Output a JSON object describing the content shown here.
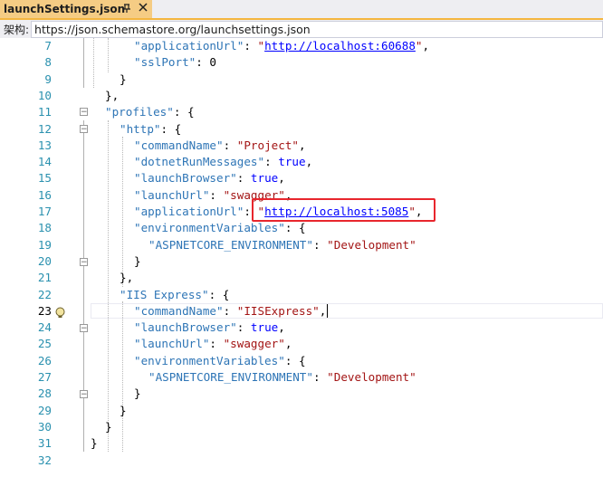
{
  "tab": {
    "title": "launchSettings.json",
    "pin_icon": "pin-icon",
    "close_icon": "close-icon"
  },
  "schema": {
    "label": "架构:",
    "url": "https://json.schemastore.org/launchsettings.json"
  },
  "editor": {
    "current_line": "23",
    "lines": [
      {
        "n": "7"
      },
      {
        "n": "8"
      },
      {
        "n": "9"
      },
      {
        "n": "10"
      },
      {
        "n": "11"
      },
      {
        "n": "12"
      },
      {
        "n": "13"
      },
      {
        "n": "14"
      },
      {
        "n": "15"
      },
      {
        "n": "16"
      },
      {
        "n": "17"
      },
      {
        "n": "18"
      },
      {
        "n": "19"
      },
      {
        "n": "20"
      },
      {
        "n": "21"
      },
      {
        "n": "22"
      },
      {
        "n": "23"
      },
      {
        "n": "24"
      },
      {
        "n": "25"
      },
      {
        "n": "26"
      },
      {
        "n": "27"
      },
      {
        "n": "28"
      },
      {
        "n": "29"
      },
      {
        "n": "30"
      },
      {
        "n": "31"
      },
      {
        "n": "32"
      }
    ],
    "tokens": {
      "applicationUrl_key": "\"applicationUrl\"",
      "url_60688": "http://localhost:60688",
      "sslPort_key": "\"sslPort\"",
      "sslPort_val": "0",
      "profiles_key": "\"profiles\"",
      "http_key": "\"http\"",
      "commandName_key": "\"commandName\"",
      "project_val": "\"Project\"",
      "dotnetRunMessages_key": "\"dotnetRunMessages\"",
      "true_val": "true",
      "launchBrowser_key": "\"launchBrowser\"",
      "launchUrl_key": "\"launchUrl\"",
      "swagger_val": "\"swagger\"",
      "url_5085": "http://localhost:5085",
      "environmentVariables_key": "\"environmentVariables\"",
      "aspnetcore_key": "\"ASPNETCORE_ENVIRONMENT\"",
      "development_val": "\"Development\"",
      "iisexpress_key": "\"IIS Express\"",
      "iisexpress_val": "\"IISExpress\"",
      "quote": "\""
    }
  },
  "colors": {
    "highlight_box": "#e8262d",
    "tab_accent": "#f5cc84"
  }
}
